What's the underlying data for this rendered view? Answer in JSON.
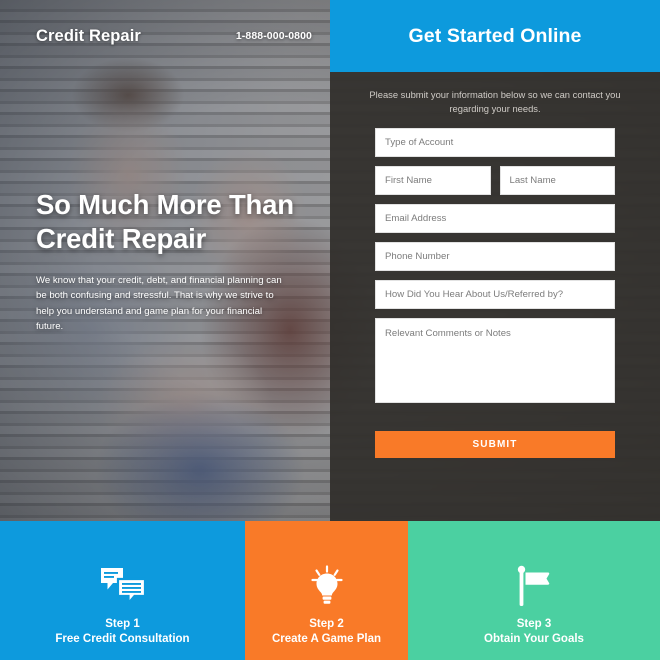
{
  "hero": {
    "brand": "Credit Repair",
    "phone": "1-888-000-0800",
    "headline_line1": "So Much More Than",
    "headline_line2": "Credit Repair",
    "subcopy": "We know that your credit, debt, and financial planning can be both confusing and stressful. That is why we strive to help you understand and game plan for your financial future."
  },
  "form": {
    "title": "Get Started Online",
    "intro": "Please submit your information below so we can contact you regarding your needs.",
    "fields": {
      "account_type": "Type of Account",
      "first_name": "First Name",
      "last_name": "Last Name",
      "email": "Email Address",
      "phone": "Phone Number",
      "referral": "How Did You Hear About Us/Referred by?",
      "comments": "Relevant Comments or Notes"
    },
    "submit_label": "SUBMIT"
  },
  "steps": [
    {
      "number": "Step 1",
      "label": "Free Credit Consultation",
      "icon": "chat-bubbles-icon",
      "color": "#0d9add"
    },
    {
      "number": "Step 2",
      "label": "Create A Game Plan",
      "icon": "lightbulb-icon",
      "color": "#f97a28"
    },
    {
      "number": "Step 3",
      "label": "Obtain Your Goals",
      "icon": "flag-icon",
      "color": "#4bd0a1"
    }
  ],
  "colors": {
    "blue": "#0d9add",
    "orange": "#f97a28",
    "green": "#4bd0a1",
    "panel_dark": "#302e2b",
    "white": "#ffffff"
  }
}
